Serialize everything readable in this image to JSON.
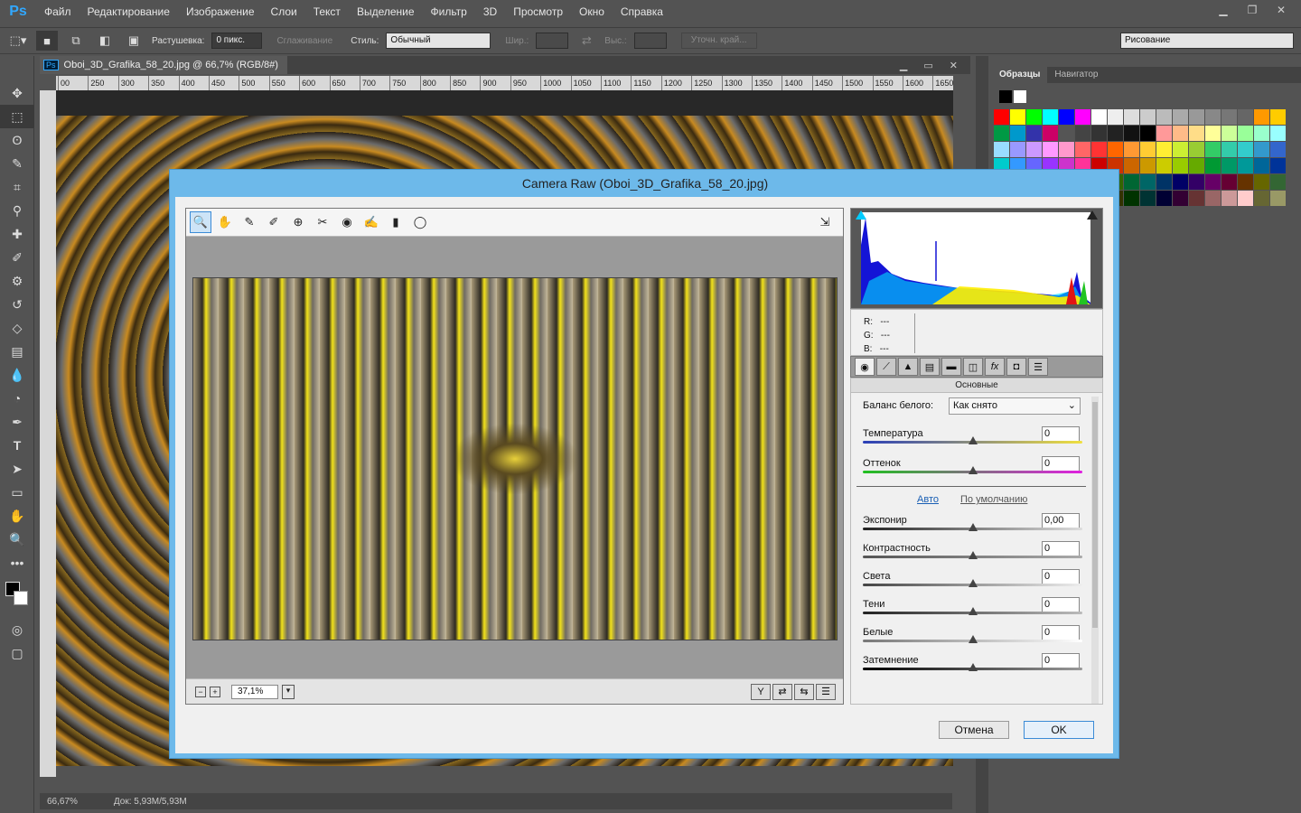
{
  "app": {
    "logo": "Ps"
  },
  "menu": [
    "Файл",
    "Редактирование",
    "Изображение",
    "Слои",
    "Текст",
    "Выделение",
    "Фильтр",
    "3D",
    "Просмотр",
    "Окно",
    "Справка"
  ],
  "options": {
    "feather_label": "Растушевка:",
    "feather_value": "0 пикс.",
    "antialias_label": "Сглаживание",
    "style_label": "Стиль:",
    "style_value": "Обычный",
    "width_label": "Шир.:",
    "height_label": "Выс.:",
    "refine_label": "Уточн. край...",
    "workspace": "Рисование"
  },
  "document": {
    "tab_title": "Oboi_3D_Grafika_58_20.jpg @ 66,7% (RGB/8#)",
    "ruler_ticks": [
      "00",
      "250",
      "300",
      "350",
      "400",
      "450",
      "500",
      "550",
      "600",
      "650",
      "700",
      "750",
      "800",
      "850",
      "900",
      "950",
      "1000",
      "1050",
      "1100",
      "1150",
      "1200",
      "1250",
      "1300",
      "1350",
      "1400",
      "1450",
      "1500",
      "1550",
      "1600",
      "1650"
    ],
    "zoom": "66,67%",
    "doc_info": "Док: 5,93M/5,93M"
  },
  "panels": {
    "tabs": [
      "Образцы",
      "Навигатор"
    ]
  },
  "swatch_colors": [
    "#ff0000",
    "#ffff00",
    "#00ff00",
    "#00ffff",
    "#0000ff",
    "#ff00ff",
    "#ffffff",
    "#eeeeee",
    "#dddddd",
    "#cccccc",
    "#bbbbbb",
    "#aaaaaa",
    "#999999",
    "#888888",
    "#777777",
    "#666666",
    "#ff9900",
    "#ffcc00",
    "#009944",
    "#0099cc",
    "#3333aa",
    "#cc0066",
    "#555555",
    "#444444",
    "#333333",
    "#222222",
    "#111111",
    "#000000",
    "#ff9999",
    "#ffbb88",
    "#ffdd88",
    "#ffff99",
    "#ccff99",
    "#99ff99",
    "#99ffcc",
    "#99ffff",
    "#99ddff",
    "#9999ff",
    "#cc99ff",
    "#ff99ff",
    "#ff99cc",
    "#ff6666",
    "#ff3333",
    "#ff6600",
    "#ff9933",
    "#ffcc33",
    "#ffee33",
    "#ccee33",
    "#99cc33",
    "#33cc66",
    "#33ccaa",
    "#33cccc",
    "#3399cc",
    "#3366cc",
    "#00cccc",
    "#3399ff",
    "#6666ff",
    "#9933ff",
    "#cc33cc",
    "#ff3399",
    "#cc0000",
    "#cc3300",
    "#cc6600",
    "#cc9900",
    "#cccc00",
    "#99cc00",
    "#66aa00",
    "#009933",
    "#009966",
    "#009999",
    "#006699",
    "#003399",
    "#6633cc",
    "#990099",
    "#990033",
    "#993300",
    "#996600",
    "#999900",
    "#669900",
    "#336600",
    "#006633",
    "#006666",
    "#003366",
    "#000066",
    "#330066",
    "#660066",
    "#660033",
    "#663300",
    "#666600",
    "#336633",
    "#996633",
    "#cc9966",
    "#ffcc99",
    "#cc9933",
    "#996600",
    "#663300",
    "#330000",
    "#333300",
    "#003300",
    "#003333",
    "#000033",
    "#330033",
    "#663333",
    "#996666",
    "#cc9999",
    "#ffcccc",
    "#666633",
    "#999966"
  ],
  "camera_raw": {
    "title": "Camera Raw (Oboi_3D_Grafika_58_20.jpg)",
    "zoom": "37,1%",
    "rgb": {
      "r_label": "R:",
      "r": "---",
      "g_label": "G:",
      "g": "---",
      "b_label": "B:",
      "b": "---"
    },
    "section": "Основные",
    "wb_label": "Баланс белого:",
    "wb_value": "Как снято",
    "auto": "Авто",
    "default": "По умолчанию",
    "sliders": [
      {
        "label": "Температура",
        "value": "0",
        "pos": 0.5
      },
      {
        "label": "Оттенок",
        "value": "0",
        "pos": 0.5
      },
      {
        "label": "Экспонир",
        "value": "0,00",
        "pos": 0.5
      },
      {
        "label": "Контрастность",
        "value": "0",
        "pos": 0.5
      },
      {
        "label": "Света",
        "value": "0",
        "pos": 0.5
      },
      {
        "label": "Тени",
        "value": "0",
        "pos": 0.5
      },
      {
        "label": "Белые",
        "value": "0",
        "pos": 0.5
      },
      {
        "label": "Затемнение",
        "value": "0",
        "pos": 0.5
      }
    ],
    "cancel": "Отмена",
    "ok": "OK"
  }
}
